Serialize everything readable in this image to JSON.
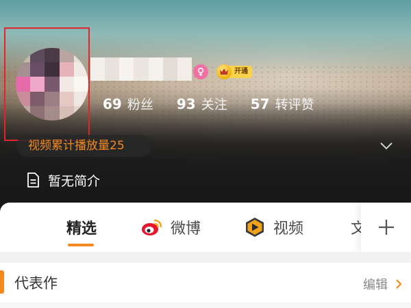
{
  "profile": {
    "stats": [
      {
        "num": "69",
        "label": "粉丝"
      },
      {
        "num": "93",
        "label": "关注"
      },
      {
        "num": "57",
        "label": "转评赞"
      }
    ],
    "vip_label": "开通",
    "play_count": "视频累计播放量25",
    "intro": "暂无简介"
  },
  "tabs": [
    {
      "label": "精选",
      "icon": null
    },
    {
      "label": "微博",
      "icon": "weibo-icon"
    },
    {
      "label": "视频",
      "icon": "video-icon"
    },
    {
      "label": "文",
      "icon": null
    }
  ],
  "section": {
    "title": "代表作",
    "edit": "编辑"
  },
  "colors": {
    "accent": "#f48a20",
    "highlight_box": "#e0262b",
    "female_badge": "#f36fa3",
    "vip_gold": "#fbd34a"
  },
  "icons": [
    "female-gender-icon",
    "vip-crown-icon",
    "chevron-down-icon",
    "document-icon",
    "weibo-icon",
    "video-icon",
    "plus-icon",
    "chevron-right-icon"
  ]
}
